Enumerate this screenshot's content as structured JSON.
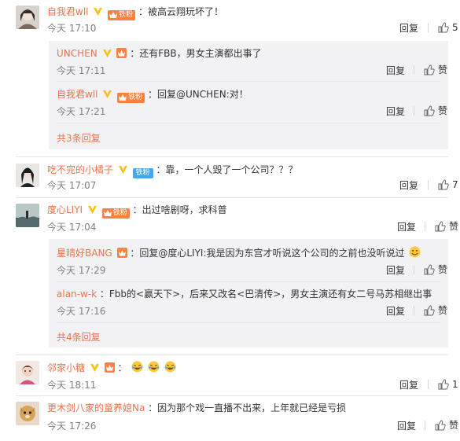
{
  "comments": [
    {
      "user": "自我君wll",
      "fan_badge": "铁粉",
      "text": "：被高云翔玩坏了！",
      "time": "今天 17:10",
      "reply_label": "回复",
      "likes": "5",
      "replies": [
        {
          "user": "UNCHEN",
          "text": "：还有FBB，男女主演都出事了",
          "time": "今天 17:11",
          "reply_label": "回复",
          "like_label": "赞"
        },
        {
          "user": "自我君wll",
          "fan_badge": "铁粉",
          "text": "：回复@UNCHEN:对！",
          "time": "今天 17:21",
          "reply_label": "回复",
          "like_label": "赞"
        }
      ],
      "more_replies": "共3条回复"
    },
    {
      "user": "吃不完的小橘子",
      "fan_badge": "铁粉",
      "text": "：靠，一个人毁了一个公司？？？",
      "time": "今天 17:07",
      "reply_label": "回复",
      "likes": "7"
    },
    {
      "user": "度心LIYI",
      "fan_badge": "铁粉",
      "text": "：出过啥剧呀，求科普",
      "time": "今天 17:04",
      "reply_label": "回复",
      "like_label": "赞",
      "replies": [
        {
          "user": "星晴好BANG",
          "text": "：回复@度心LIYI:我是因为东宫才听说这个公司的之前也没听说过",
          "time": "今天 17:29",
          "reply_label": "回复",
          "like_label": "赞"
        },
        {
          "user": "alan-w-k",
          "text": "：Fbb的<赢天下>，后来又改名<巴清传>，男女主演还有女二号马苏相继出事",
          "time": "今天 17:16",
          "reply_label": "回复",
          "like_label": "赞"
        }
      ],
      "more_replies": "共4条回复"
    },
    {
      "user": "邻家小糖",
      "text": "：",
      "time": "今天 18:11",
      "reply_label": "回复",
      "likes": "1"
    },
    {
      "user": "更木剑八家的童养媳Na",
      "text": "：因为那个戏一直播不出来，上年就已经是亏损",
      "time": "今天 17:26",
      "reply_label": "回复",
      "like_label": "赞"
    }
  ],
  "colors": {
    "username": "#eb7350",
    "meta": "#808080",
    "subbox_bg": "#f2f2f5",
    "verified": "#ffc000",
    "fan_badge": "#ff8140"
  }
}
